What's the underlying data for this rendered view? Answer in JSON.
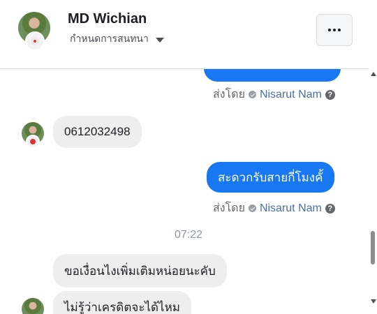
{
  "header": {
    "name": "MD Wichian",
    "subtitle": "กำหนดการสนทนา"
  },
  "messages": [
    {
      "type": "outgoing_partial"
    },
    {
      "type": "sent_by",
      "prefix": "ส่งโดย",
      "sender": "Nisarut Nam"
    },
    {
      "type": "incoming",
      "text": "0612032498"
    },
    {
      "type": "outgoing",
      "text": "สะดวกรับสายกี่โมงคั้"
    },
    {
      "type": "sent_by",
      "prefix": "ส่งโดย",
      "sender": "Nisarut Nam"
    },
    {
      "type": "timestamp",
      "text": "07:22"
    },
    {
      "type": "incoming",
      "text": "ขอเงื่อนไงเพิ่มเติมหน่อยนะคับ"
    },
    {
      "type": "incoming_partial",
      "text": "ไม่รู้ว่าเครดิตจะได้ไหม"
    }
  ],
  "scrollbar": {
    "position": 0.82
  }
}
